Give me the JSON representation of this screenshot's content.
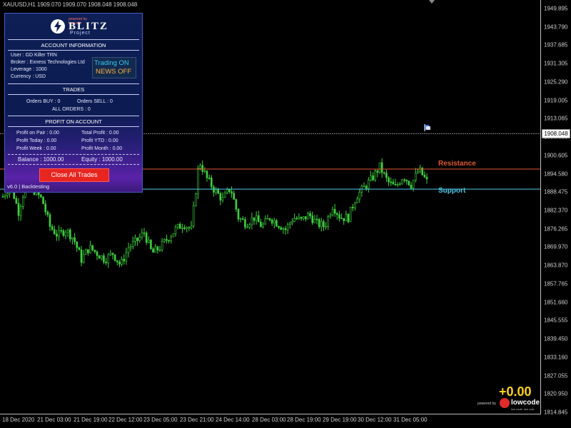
{
  "window": {
    "symbol_info": "XAUUSD,H1  1909.070 1909.070 1908.048 1908.048"
  },
  "price_axis": {
    "ticks": [
      "1949.895",
      "1943.790",
      "1937.685",
      "1931.305",
      "1925.290",
      "1919.005",
      "1913.065",
      "1906.685",
      "1900.605",
      "1894.580",
      "1888.475",
      "1882.370",
      "1876.265",
      "1869.970",
      "1863.870",
      "1857.765",
      "1851.660",
      "1845.555",
      "1839.450",
      "1833.160",
      "1827.055",
      "1820.950",
      "1814.845"
    ],
    "current_price": "1908.048"
  },
  "time_axis": {
    "labels": [
      "18 Dec 2020",
      "21 Dec 03:00",
      "21 Dec 19:00",
      "22 Dec 12:00",
      "23 Dec 05:00",
      "23 Dec 21:00",
      "24 Dec 14:00",
      "28 Dec 03:00",
      "28 Dec 19:00",
      "29 Dec 19:00",
      "30 Dec 12:00",
      "31 Dec 05:00"
    ]
  },
  "lines": {
    "resistance_label": "Resistance",
    "support_label": "Support",
    "colors": {
      "resistance": "#e0592f",
      "support": "#4fc9e6",
      "candle": "#3fd13f",
      "background": "#000000"
    }
  },
  "panel": {
    "logo": {
      "name": "BLITZ",
      "sub": "Project",
      "powered_mini": "powered by lowcode"
    },
    "account_title": "ACCOUNT INFORMATION",
    "user": "User : GD Killer TRN",
    "broker": "Broker : Exness Technologies Ltd",
    "leverage": "Leverage : 1000",
    "currency": "Currency : USD",
    "trading_status": "Trading ON",
    "news_status": "NEWS OFF",
    "trades_title": "TRADES",
    "orders_buy": "Orders BUY : 0",
    "orders_sell": "Orders SELL : 0",
    "all_orders": "ALL ORDERS : 0",
    "profit_title": "PROFIT ON ACCOUNT",
    "profit_pair": "Profit on Pair : 0.00",
    "profit_today": "Profit Today : 0.00",
    "profit_week": "Profit Week : 0.00",
    "total_profit": "Total Profit : 0.00",
    "profit_ytd": "Profit YTD : 0.00",
    "profit_month": "Profit Month : 0.00",
    "balance": "Balance : 1000.00",
    "equity": "Equity : 1000.00",
    "close_all_label": "Close All Trades",
    "version": "v6.0 | Backtesting"
  },
  "overlay": {
    "profit_value": "+0.00",
    "powered_by": "powered by",
    "brand": "lowcode",
    "brand_sub": "low code. low cost"
  },
  "chart_data": {
    "type": "candlestick",
    "symbol": "XAUUSD",
    "timeframe": "H1",
    "ylim": [
      1814.845,
      1949.895
    ],
    "resistance": 1896.2,
    "support": 1889.5,
    "current_price": 1908.048,
    "close_path": [
      1887,
      1891,
      1882,
      1892,
      1889,
      1886,
      1877,
      1874,
      1876,
      1873,
      1866,
      1870,
      1868,
      1866,
      1868,
      1864,
      1870,
      1872,
      1875,
      1868,
      1870,
      1873,
      1876,
      1878,
      1876,
      1899,
      1893,
      1889,
      1886,
      1890,
      1880,
      1878,
      1880,
      1877,
      1880,
      1878,
      1876,
      1880,
      1879,
      1881,
      1878,
      1877,
      1884,
      1880,
      1880,
      1887,
      1890,
      1893,
      1897,
      1892,
      1890,
      1894,
      1891,
      1896,
      1892
    ]
  }
}
